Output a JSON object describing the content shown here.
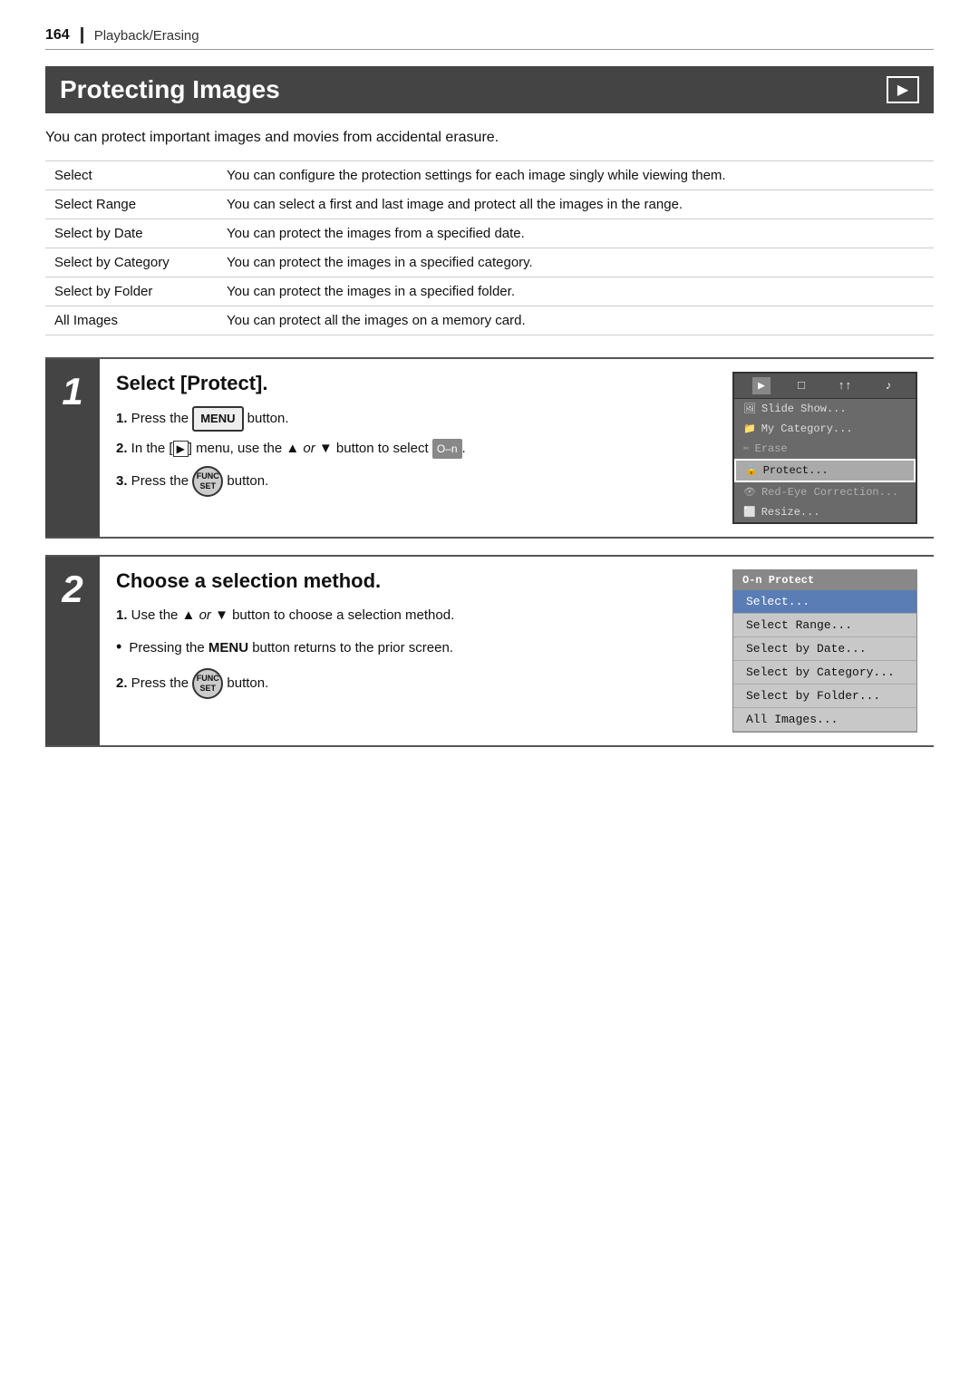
{
  "header": {
    "page_number": "164",
    "section_label": "Playback/Erasing"
  },
  "title_section": {
    "title": "Protecting Images",
    "playback_icon": "▶"
  },
  "intro": {
    "text": "You can protect important images and movies from accidental erasure."
  },
  "table": {
    "rows": [
      {
        "label": "Select",
        "description": "You can configure the protection settings for each image singly while viewing them."
      },
      {
        "label": "Select Range",
        "description": "You can select a first and last image and protect all the images in the range."
      },
      {
        "label": "Select by Date",
        "description": "You can protect the images from a specified date."
      },
      {
        "label": "Select by Category",
        "description": "You can protect the images in a specified category."
      },
      {
        "label": "Select by Folder",
        "description": "You can protect the images in a specified folder."
      },
      {
        "label": "All Images",
        "description": "You can protect all the images on a memory card."
      }
    ]
  },
  "step1": {
    "number": "1",
    "title": "Select [Protect].",
    "instructions": [
      {
        "num": "1",
        "text_parts": [
          {
            "type": "text",
            "value": "Press the "
          },
          {
            "type": "btn_menu",
            "value": "MENU"
          },
          {
            "type": "text",
            "value": " button."
          }
        ]
      },
      {
        "num": "2",
        "text_parts": [
          {
            "type": "text",
            "value": "In the ["
          },
          {
            "type": "playback_icon",
            "value": "▶"
          },
          {
            "type": "text",
            "value": "] menu, use the ▲ or ▼ button to select "
          },
          {
            "type": "protect_icon",
            "value": "O-n"
          },
          {
            "type": "text",
            "value": "."
          }
        ]
      },
      {
        "num": "3",
        "text_parts": [
          {
            "type": "text",
            "value": "Press the "
          },
          {
            "type": "btn_func",
            "value": "FUNC\nSET"
          },
          {
            "type": "text",
            "value": " button."
          }
        ]
      }
    ],
    "menu": {
      "tabs": [
        "▶",
        "□",
        "↑↑",
        "🔊"
      ],
      "items": [
        {
          "icon": "🖼",
          "label": "Slide Show...",
          "selected": false
        },
        {
          "icon": "📂",
          "label": "My Category...",
          "selected": false
        },
        {
          "icon": "🗑",
          "label": "Erase",
          "selected": false
        },
        {
          "icon": "O-n",
          "label": "Protect...",
          "selected": true
        },
        {
          "icon": "👁",
          "label": "Red-Eye Correction...",
          "selected": false
        },
        {
          "icon": "📐",
          "label": "Resize...",
          "selected": false
        }
      ]
    }
  },
  "step2": {
    "number": "2",
    "title": "Choose a selection method.",
    "instructions": [
      {
        "num": "1",
        "text": "Use the ▲ or ▼ button to choose a selection method."
      }
    ],
    "bullet": {
      "text_parts": [
        {
          "type": "text",
          "value": "Pressing the "
        },
        {
          "type": "bold",
          "value": "MENU"
        },
        {
          "type": "text",
          "value": " button returns to the prior screen."
        }
      ]
    },
    "instruction2": {
      "num": "2",
      "text_parts": [
        {
          "type": "text",
          "value": "Press the "
        },
        {
          "type": "btn_func",
          "value": "FUNC\nSET"
        },
        {
          "type": "text",
          "value": " button."
        }
      ]
    },
    "protect_menu": {
      "title": "O-n  Protect",
      "items": [
        {
          "label": "Select...",
          "selected": true
        },
        {
          "label": "Select Range...",
          "selected": false
        },
        {
          "label": "Select by Date...",
          "selected": false
        },
        {
          "label": "Select by Category...",
          "selected": false
        },
        {
          "label": "Select by Folder...",
          "selected": false
        },
        {
          "label": "All Images...",
          "selected": false
        }
      ]
    }
  }
}
